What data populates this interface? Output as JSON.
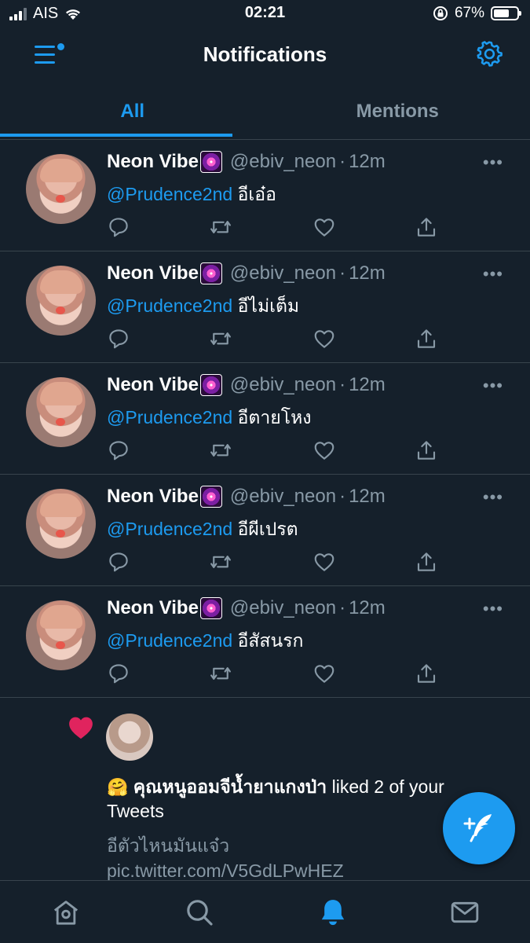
{
  "status_bar": {
    "carrier": "AIS",
    "time": "02:21",
    "battery_percent": "67%",
    "battery_level": 0.67
  },
  "header": {
    "title": "Notifications",
    "menu_icon": "menu-icon",
    "settings_icon": "gear-icon"
  },
  "tabs": [
    {
      "label": "All",
      "active": true
    },
    {
      "label": "Mentions",
      "active": false
    }
  ],
  "tweets": [
    {
      "name": "Neon Vibe",
      "handle": "@ebiv_neon",
      "dot": "·",
      "time": "12m",
      "mention": "@Prudence2nd",
      "text": "อีเอ๋อ",
      "more": "•••"
    },
    {
      "name": "Neon Vibe",
      "handle": "@ebiv_neon",
      "dot": "·",
      "time": "12m",
      "mention": "@Prudence2nd",
      "text": "อีไม่เต็ม",
      "more": "•••"
    },
    {
      "name": "Neon Vibe",
      "handle": "@ebiv_neon",
      "dot": "·",
      "time": "12m",
      "mention": "@Prudence2nd",
      "text": "อีตายโหง",
      "more": "•••"
    },
    {
      "name": "Neon Vibe",
      "handle": "@ebiv_neon",
      "dot": "·",
      "time": "12m",
      "mention": "@Prudence2nd",
      "text": "อีผีเปรต",
      "more": "•••"
    },
    {
      "name": "Neon Vibe",
      "handle": "@ebiv_neon",
      "dot": "·",
      "time": "12m",
      "mention": "@Prudence2nd",
      "text": "อีสัสนรก",
      "more": "•••"
    }
  ],
  "like_notification": {
    "emoji": "🤗",
    "liker_name": "คุณหนูออมจีน้ำยาแกงป่า",
    "action_text": " liked 2 of your Tweets",
    "tweet_preview": "อีตัวไหนมันแจ๋ว pic.twitter.com/V5GdLPwHEZ"
  },
  "colors": {
    "background": "#15202b",
    "accent": "#1d9bf0",
    "secondary_text": "#8899a6",
    "like_red": "#e0245e",
    "divider": "#38444d"
  },
  "bottom_nav": [
    {
      "icon": "home-icon",
      "active": false
    },
    {
      "icon": "search-icon",
      "active": false
    },
    {
      "icon": "bell-icon",
      "active": true
    },
    {
      "icon": "mail-icon",
      "active": false
    }
  ]
}
